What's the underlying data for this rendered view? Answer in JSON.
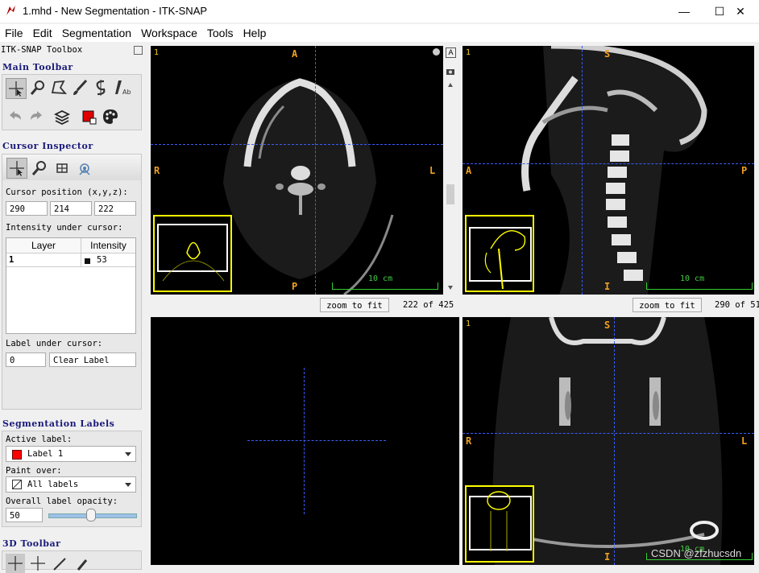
{
  "window": {
    "title": "1.mhd - New Segmentation - ITK-SNAP",
    "min": "—",
    "max": "☐",
    "close": "✕"
  },
  "menu": [
    "File",
    "Edit",
    "Segmentation",
    "Workspace",
    "Tools",
    "Help"
  ],
  "toolbox": {
    "title": "ITK-SNAP Toolbox",
    "main_toolbar": "Main Toolbar",
    "cursor_inspector": "Cursor Inspector",
    "cursor_position_label": "Cursor position (x,y,z):",
    "cursor_position": [
      "290",
      "214",
      "222"
    ],
    "intensity_label": "Intensity under cursor:",
    "table_headers": [
      "Layer",
      "Intensity"
    ],
    "table_rows": [
      {
        "layer": "1",
        "intensity": "53"
      }
    ],
    "label_under_cursor_label": "Label under cursor:",
    "label_value": "0",
    "label_name": "Clear Label",
    "seg_labels": "Segmentation Labels",
    "active_label_label": "Active label:",
    "active_label": "Label 1",
    "paint_over_label": "Paint over:",
    "paint_over": "All labels",
    "opacity_label": "Overall label opacity:",
    "opacity": "50",
    "toolbar3d": "3D Toolbar"
  },
  "views": {
    "axial": {
      "num": "1",
      "top": "A",
      "bottom": "P",
      "left": "R",
      "right": "L",
      "scale": "10 cm",
      "zoom_btn": "zoom to fit",
      "slice": "222 of 425"
    },
    "sagittal": {
      "num": "1",
      "top": "S",
      "bottom": "I",
      "left": "A",
      "right": "P",
      "scale": "10 cm",
      "zoom_btn": "zoom to fit",
      "slice": "290 of 51"
    },
    "coronal": {
      "num": "1",
      "top": "S",
      "bottom": "I",
      "left": "R",
      "right": "L",
      "scale": "10 cm"
    }
  },
  "watermark": "CSDN @zfzhucsdn",
  "colors": {
    "crosshair": "#3a5cff",
    "orient": "#f0a020",
    "thumb": "#ffff00",
    "label1": "#ff0000"
  }
}
